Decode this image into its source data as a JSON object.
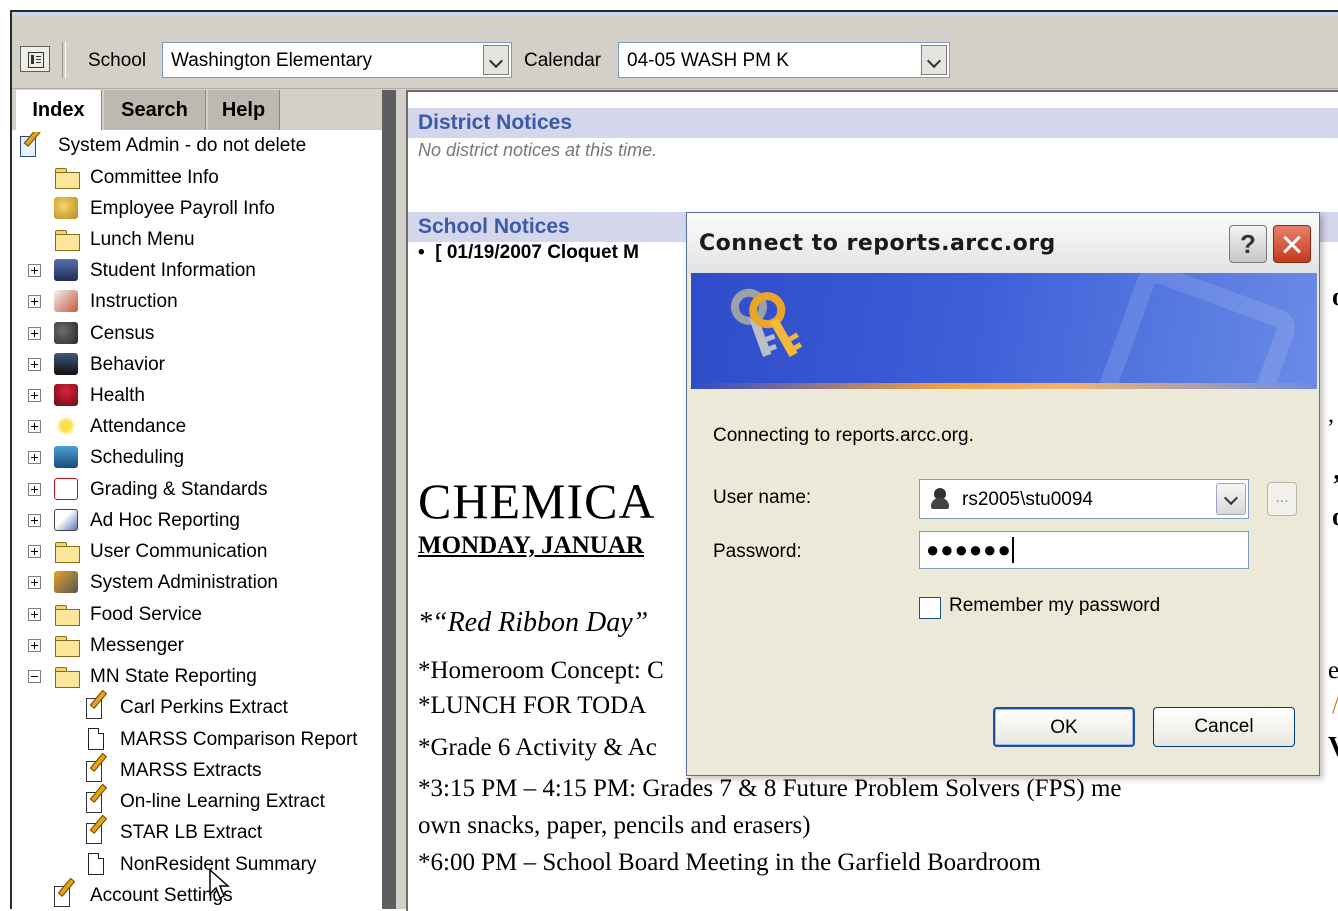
{
  "toolbar": {
    "school_label": "School",
    "school_value": "Washington Elementary",
    "calendar_label": "Calendar",
    "calendar_value": "04-05 WASH PM K"
  },
  "tabs": [
    "Index",
    "Search",
    "Help"
  ],
  "tree": [
    {
      "label": "System Admin - do not delete",
      "icon": "admin-icon"
    },
    {
      "label": "Committee Info",
      "icon": "folder-icon"
    },
    {
      "label": "Employee Payroll Info",
      "icon": "payroll-icon"
    },
    {
      "label": "Lunch Menu",
      "icon": "folder-icon"
    },
    {
      "label": "Student Information",
      "icon": "student-icon",
      "expander": "+"
    },
    {
      "label": "Instruction",
      "icon": "instruction-icon",
      "expander": "+"
    },
    {
      "label": "Census",
      "icon": "census-icon",
      "expander": "+"
    },
    {
      "label": "Behavior",
      "icon": "behavior-icon",
      "expander": "+"
    },
    {
      "label": "Health",
      "icon": "health-icon",
      "expander": "+"
    },
    {
      "label": "Attendance",
      "icon": "attendance-icon",
      "expander": "+"
    },
    {
      "label": "Scheduling",
      "icon": "scheduling-icon",
      "expander": "+"
    },
    {
      "label": "Grading & Standards",
      "icon": "grading-icon",
      "expander": "+"
    },
    {
      "label": "Ad Hoc Reporting",
      "icon": "adhoc-icon",
      "expander": "+"
    },
    {
      "label": "User Communication",
      "icon": "folder-icon",
      "expander": "+"
    },
    {
      "label": "System Administration",
      "icon": "sysadmin-icon",
      "expander": "+"
    },
    {
      "label": "Food Service",
      "icon": "folder-icon",
      "expander": "+"
    },
    {
      "label": "Messenger",
      "icon": "folder-icon",
      "expander": "+"
    },
    {
      "label": "MN State Reporting",
      "icon": "folder-icon",
      "expander": "-"
    },
    {
      "label": "Carl Perkins Extract",
      "icon": "report-icon"
    },
    {
      "label": "MARSS Comparison Report",
      "icon": "document-icon"
    },
    {
      "label": "MARSS Extracts",
      "icon": "report-icon"
    },
    {
      "label": "On-line Learning Extract",
      "icon": "report-icon"
    },
    {
      "label": "STAR LB Extract",
      "icon": "report-icon"
    },
    {
      "label": "NonResident Summary",
      "icon": "document-icon"
    },
    {
      "label": "Account Settings",
      "icon": "report-icon"
    }
  ],
  "main": {
    "district_heading": "District Notices",
    "district_empty": "No district notices at this time.",
    "school_heading": "School Notices",
    "notice_bullet": "[ 01/19/2007 Cloquet M",
    "chem_heading": "CHEMICA",
    "monday": "MONDAY, JANUAR",
    "red_ribbon": "*“Red Ribbon Day”",
    "lines": [
      "*Homeroom Concept: C",
      "*LUNCH FOR TODA",
      "*Grade 6 Activity & Ac",
      "*3:15 PM – 4:15 PM:  Grades 7 & 8 Future Problem Solvers (FPS) me",
      "own snacks, paper, pencils and erasers)",
      "*6:00 PM – School Board Meeting in the Garfield Boardroom"
    ],
    "right_fragments": [
      "o",
      ", ‘",
      "’",
      "o",
      "er",
      "/",
      "V"
    ]
  },
  "dialog": {
    "title": "Connect to reports.arcc.org",
    "help_glyph": "?",
    "connecting_text": "Connecting to reports.arcc.org.",
    "user_label": "User name:",
    "user_value": "rs2005\\stu0094",
    "browse_glyph": "...",
    "password_label": "Password:",
    "password_value": "●●●●●●",
    "remember_label": "Remember my password",
    "remember_checked": false,
    "ok_label": "OK",
    "cancel_label": "Cancel"
  },
  "colors": {
    "section_header_bg": "#d4d6ec",
    "section_header_text": "#3a5aa8",
    "banner_blue": "#2f4bc9"
  }
}
